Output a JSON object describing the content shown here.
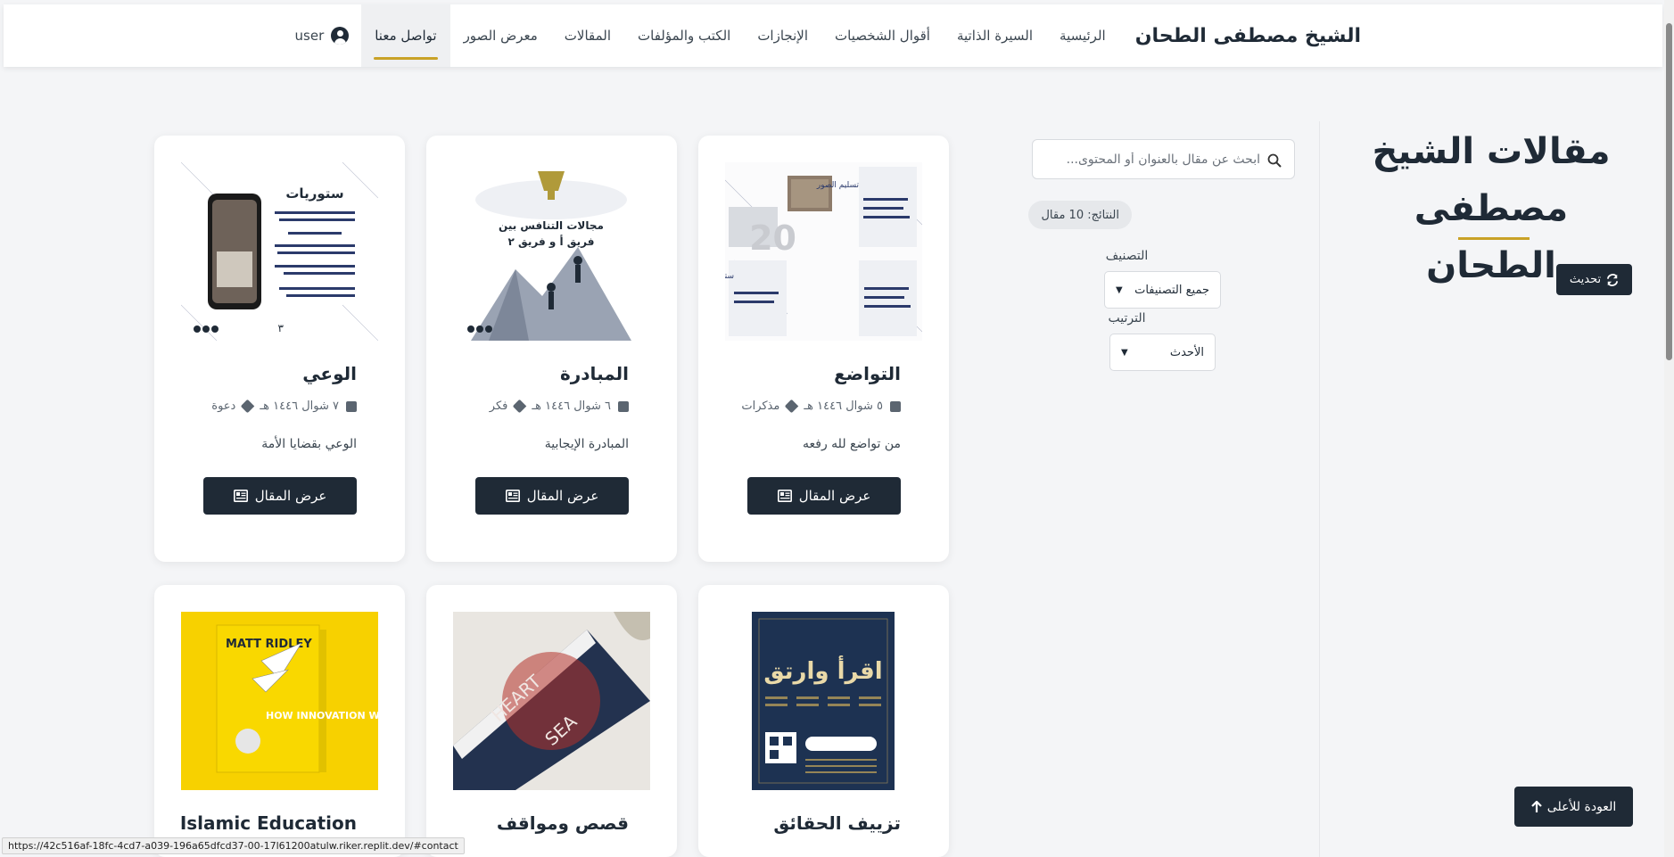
{
  "nav": {
    "brand": "الشيخ مصطفى الطحان",
    "links": [
      "الرئيسية",
      "السيرة الذاتية",
      "أقوال الشخصيات",
      "الإنجازات",
      "الكتب والمؤلفات",
      "المقالات",
      "معرض الصور",
      "تواصل معنا"
    ],
    "active": "تواصل معنا",
    "user_label": "user"
  },
  "header": {
    "title_line1": "مقالات الشيخ",
    "title_line2": "مصطفى الطحان",
    "refresh_label": "تحديث"
  },
  "filters": {
    "search_placeholder": "ابحث عن مقال بالعنوان أو المحتوى...",
    "results_text": "النتائج: 10 مقال",
    "category_label": "التصنيف",
    "category_value": "جميع التصنيفات",
    "sort_label": "الترتيب",
    "sort_value": "الأحدث"
  },
  "cards": [
    {
      "title": "التواضع",
      "date": "٥ شوال ١٤٤٦ هـ",
      "category": "مذكرات",
      "desc": "من تواضع لله رفعه",
      "button": "عرض المقال",
      "img_text_1": "تسليم الصور",
      "img_text_2": "ستوريات"
    },
    {
      "title": "المبادرة",
      "date": "٦ شوال ١٤٤٦ هـ",
      "category": "فكر",
      "desc": "المبادرة الإيجابية",
      "button": "عرض المقال",
      "img_text_1": "مجالات التنافس بين",
      "img_text_2": "فريق أ و فريق ٢"
    },
    {
      "title": "الوعي",
      "date": "٧ شوال ١٤٤٦ هـ",
      "category": "دعوة",
      "desc": "الوعي بقضايا الأمة",
      "button": "عرض المقال",
      "img_text_1": "ستوريات"
    },
    {
      "title": "تزييف الحقائق",
      "img_text_1": "اقرأ وارتق"
    },
    {
      "title": "قصص ومواقف",
      "img_text_1": "HEART",
      "img_text_2": "SEA"
    },
    {
      "title": "Islamic Education",
      "img_text_1": "MATT RIDLEY",
      "img_text_2": "HOW INNOVATION WORKS"
    }
  ],
  "back_to_top": "العودة للأعلى",
  "status_url": "https://42c516af-18fc-4cd7-a039-196a65dfcd37-00-17l61200atulw.riker.replit.dev/#contact",
  "colors": {
    "primary": "#1f2a36",
    "accent": "#c9a227",
    "background": "#f4f5f7"
  }
}
